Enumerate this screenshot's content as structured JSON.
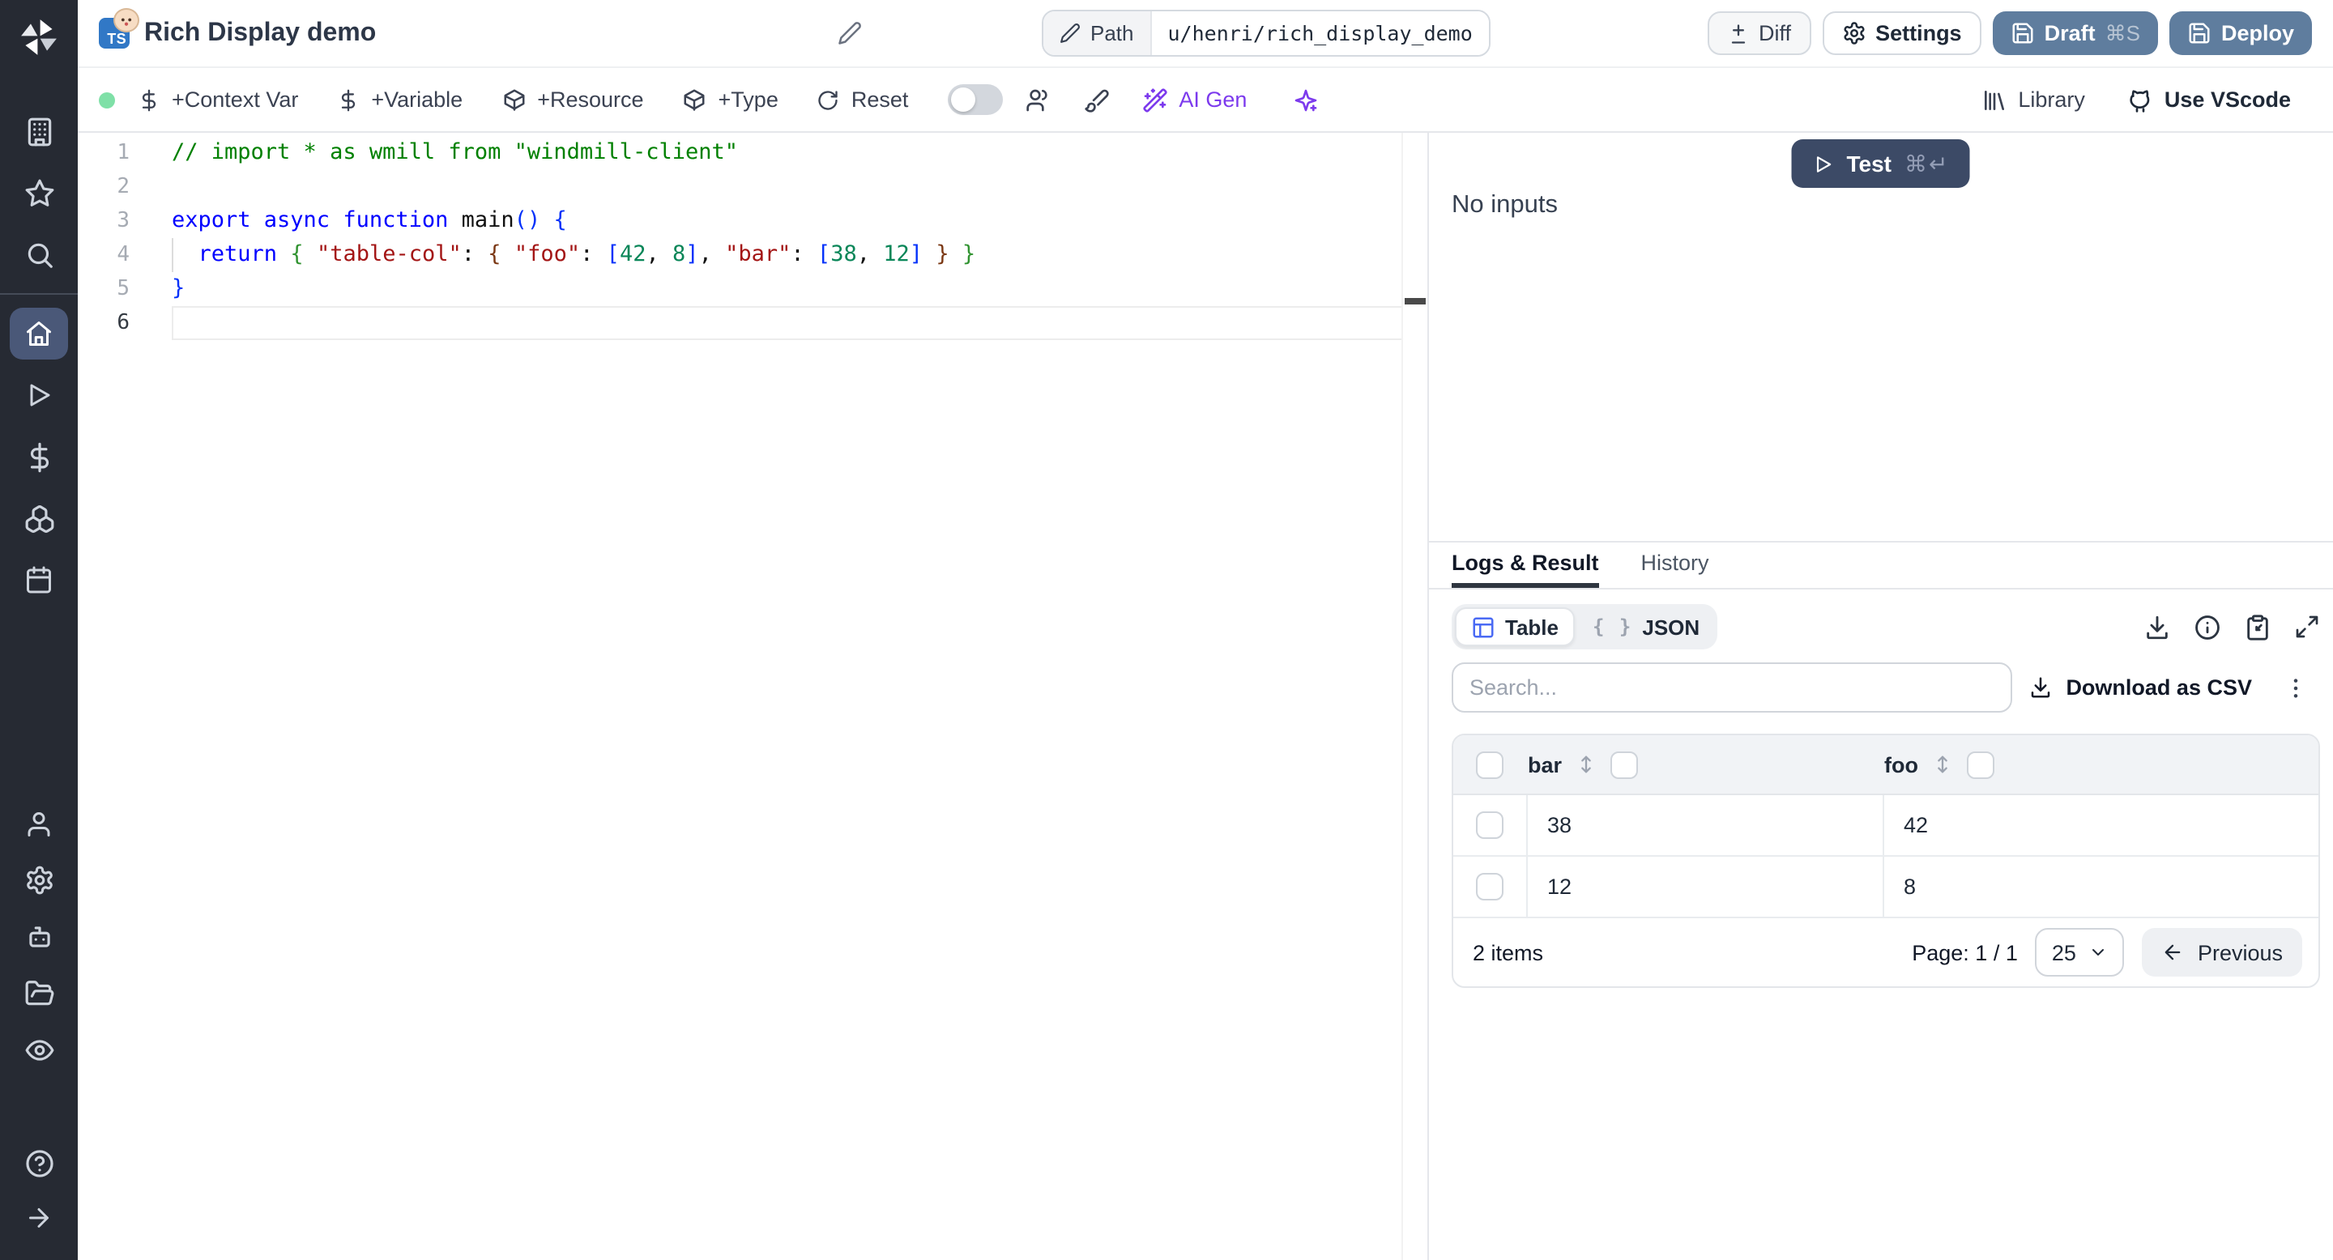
{
  "colors": {
    "sidebar_bg": "#262a33",
    "sidebar_active_bg": "#4a5878",
    "primary_button": "#5f7d9e",
    "test_button": "#3c4a66",
    "ai_violet": "#7c3aed",
    "status_green": "#7fe0a7",
    "table_icon_blue": "#4a6af4",
    "tab_underline": "#2f3640"
  },
  "sidebar": {
    "icons_top": [
      "workspace-building",
      "favorites-star",
      "search"
    ],
    "icons_main": [
      "home",
      "runs-play",
      "variables-dollar",
      "resources-boxes",
      "schedules-calendar"
    ],
    "icons_lower": [
      "user",
      "settings-gear",
      "workers-robot",
      "folders",
      "audit-eye"
    ],
    "icons_bottom": [
      "help-circle",
      "expand-arrow-right"
    ],
    "active_item": "home"
  },
  "header": {
    "language_badge": "TS",
    "title": "Rich Display demo",
    "path_label": "Path",
    "path_value": "u/henri/rich_display_demo",
    "diff_label": "Diff",
    "settings_label": "Settings",
    "draft_label": "Draft",
    "draft_shortcut": "⌘S",
    "deploy_label": "Deploy"
  },
  "toolbar": {
    "items": [
      "+Context Var",
      "+Variable",
      "+Resource",
      "+Type",
      "Reset"
    ],
    "ai_gen_label": "AI Gen",
    "library_label": "Library",
    "vscode_label": "Use VScode"
  },
  "editor": {
    "active_line": 6,
    "lines": [
      [
        [
          "// import * as wmill from \"windmill-client\"",
          "com"
        ]
      ],
      [],
      [
        [
          "export async function ",
          "kw"
        ],
        [
          "main",
          "pl"
        ],
        [
          "(",
          "b1"
        ],
        [
          ")",
          "b1"
        ],
        [
          " ",
          "pl"
        ],
        [
          "{",
          "b1"
        ]
      ],
      [
        [
          "  ",
          "pl"
        ],
        [
          "return",
          "kw"
        ],
        [
          " ",
          "pl"
        ],
        [
          "{",
          "b2"
        ],
        [
          " ",
          "pl"
        ],
        [
          "\"table-col\"",
          "str"
        ],
        [
          ": ",
          "pl"
        ],
        [
          "{",
          "b3"
        ],
        [
          " ",
          "pl"
        ],
        [
          "\"foo\"",
          "str"
        ],
        [
          ": ",
          "pl"
        ],
        [
          "[",
          "b1"
        ],
        [
          "42",
          "num"
        ],
        [
          ", ",
          "pl"
        ],
        [
          "8",
          "num"
        ],
        [
          "]",
          "b1"
        ],
        [
          ", ",
          "pl"
        ],
        [
          "\"bar\"",
          "str"
        ],
        [
          ": ",
          "pl"
        ],
        [
          "[",
          "b1"
        ],
        [
          "38",
          "num"
        ],
        [
          ", ",
          "pl"
        ],
        [
          "12",
          "num"
        ],
        [
          "]",
          "b1"
        ],
        [
          " ",
          "pl"
        ],
        [
          "}",
          "b3"
        ],
        [
          " ",
          "pl"
        ],
        [
          "}",
          "b2"
        ]
      ],
      [
        [
          "}",
          "b1"
        ]
      ],
      []
    ]
  },
  "run_panel": {
    "test_label": "Test",
    "test_shortcut": "⌘↵",
    "no_inputs": "No inputs"
  },
  "result_panel": {
    "tabs": [
      "Logs & Result",
      "History"
    ],
    "active_tab": "Logs & Result",
    "view_table_label": "Table",
    "view_json_label": "JSON",
    "json_braces": "{ }",
    "search_placeholder": "Search...",
    "download_csv_label": "Download as CSV",
    "table": {
      "columns": [
        "bar",
        "foo"
      ],
      "rows": [
        [
          "38",
          "42"
        ],
        [
          "12",
          "8"
        ]
      ]
    },
    "footer": {
      "items_count": "2 items",
      "page_label": "Page: 1 / 1",
      "page_size": "25",
      "previous_label": "Previous"
    }
  }
}
